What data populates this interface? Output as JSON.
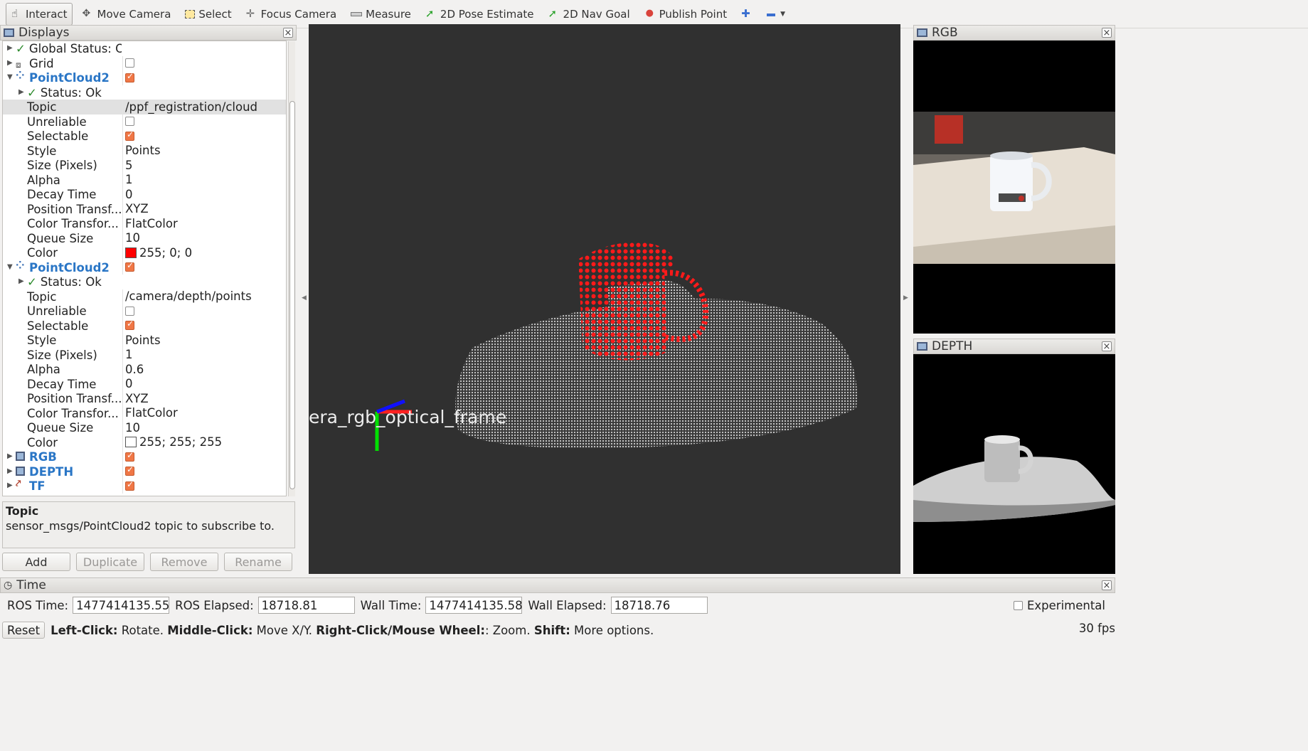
{
  "toolbar": {
    "tools": [
      {
        "label": "Interact",
        "icon": "hand-icon"
      },
      {
        "label": "Move Camera",
        "icon": "move-icon"
      },
      {
        "label": "Select",
        "icon": "select-icon"
      },
      {
        "label": "Focus Camera",
        "icon": "focus-icon"
      },
      {
        "label": "Measure",
        "icon": "ruler-icon"
      },
      {
        "label": "2D Pose Estimate",
        "icon": "green-arrow-icon"
      },
      {
        "label": "2D Nav Goal",
        "icon": "green-arrow-icon"
      },
      {
        "label": "Publish Point",
        "icon": "map-pin-icon"
      }
    ]
  },
  "displays": {
    "title": "Displays",
    "rows": [
      {
        "label": "Global Status: Ok"
      },
      {
        "label": "Grid"
      },
      {
        "label": "PointCloud2"
      },
      {
        "label": "Status: Ok"
      },
      {
        "label": "Topic",
        "value": "/ppf_registration/cloud"
      },
      {
        "label": "Unreliable"
      },
      {
        "label": "Selectable"
      },
      {
        "label": "Style",
        "value": "Points"
      },
      {
        "label": "Size (Pixels)",
        "value": "5"
      },
      {
        "label": "Alpha",
        "value": "1"
      },
      {
        "label": "Decay Time",
        "value": "0"
      },
      {
        "label": "Position Transf...",
        "value": "XYZ"
      },
      {
        "label": "Color Transfor...",
        "value": "FlatColor"
      },
      {
        "label": "Queue Size",
        "value": "10"
      },
      {
        "label": "Color",
        "value": "255; 0; 0"
      },
      {
        "label": "PointCloud2"
      },
      {
        "label": "Status: Ok"
      },
      {
        "label": "Topic",
        "value": "/camera/depth/points"
      },
      {
        "label": "Unreliable"
      },
      {
        "label": "Selectable"
      },
      {
        "label": "Style",
        "value": "Points"
      },
      {
        "label": "Size (Pixels)",
        "value": "1"
      },
      {
        "label": "Alpha",
        "value": "0.6"
      },
      {
        "label": "Decay Time",
        "value": "0"
      },
      {
        "label": "Position Transf...",
        "value": "XYZ"
      },
      {
        "label": "Color Transfor...",
        "value": "FlatColor"
      },
      {
        "label": "Queue Size",
        "value": "10"
      },
      {
        "label": "Color",
        "value": "255; 255; 255"
      },
      {
        "label": "RGB"
      },
      {
        "label": "DEPTH"
      },
      {
        "label": "TF"
      }
    ]
  },
  "description": {
    "title": "Topic",
    "text": "sensor_msgs/PointCloud2 topic to subscribe to."
  },
  "buttons": {
    "add": "Add",
    "duplicate": "Duplicate",
    "remove": "Remove",
    "rename": "Rename"
  },
  "view": {
    "frame_label": "era_rgb_optical_frame"
  },
  "rgb_panel": {
    "title": "RGB"
  },
  "depth_panel": {
    "title": "DEPTH"
  },
  "time": {
    "title": "Time",
    "ros_time_label": "ROS Time:",
    "ros_time": "1477414135.55",
    "ros_elapsed_label": "ROS Elapsed:",
    "ros_elapsed": "18718.81",
    "wall_time_label": "Wall Time:",
    "wall_time": "1477414135.58",
    "wall_elapsed_label": "Wall Elapsed:",
    "wall_elapsed": "18718.76",
    "experimental": "Experimental"
  },
  "status": {
    "reset": "Reset",
    "hint_left_key": "Left-Click:",
    "hint_left": " Rotate. ",
    "hint_middle_key": "Middle-Click:",
    "hint_middle": " Move X/Y. ",
    "hint_right_key": "Right-Click/Mouse Wheel:",
    "hint_right": ": Zoom. ",
    "hint_shift_key": "Shift:",
    "hint_shift": " More options.",
    "fps": "30 fps"
  },
  "colors": {
    "accent": "#2a76c6",
    "cloud_red": "#ff0000",
    "checkbox": "#f07746",
    "view_bg": "#303030"
  }
}
